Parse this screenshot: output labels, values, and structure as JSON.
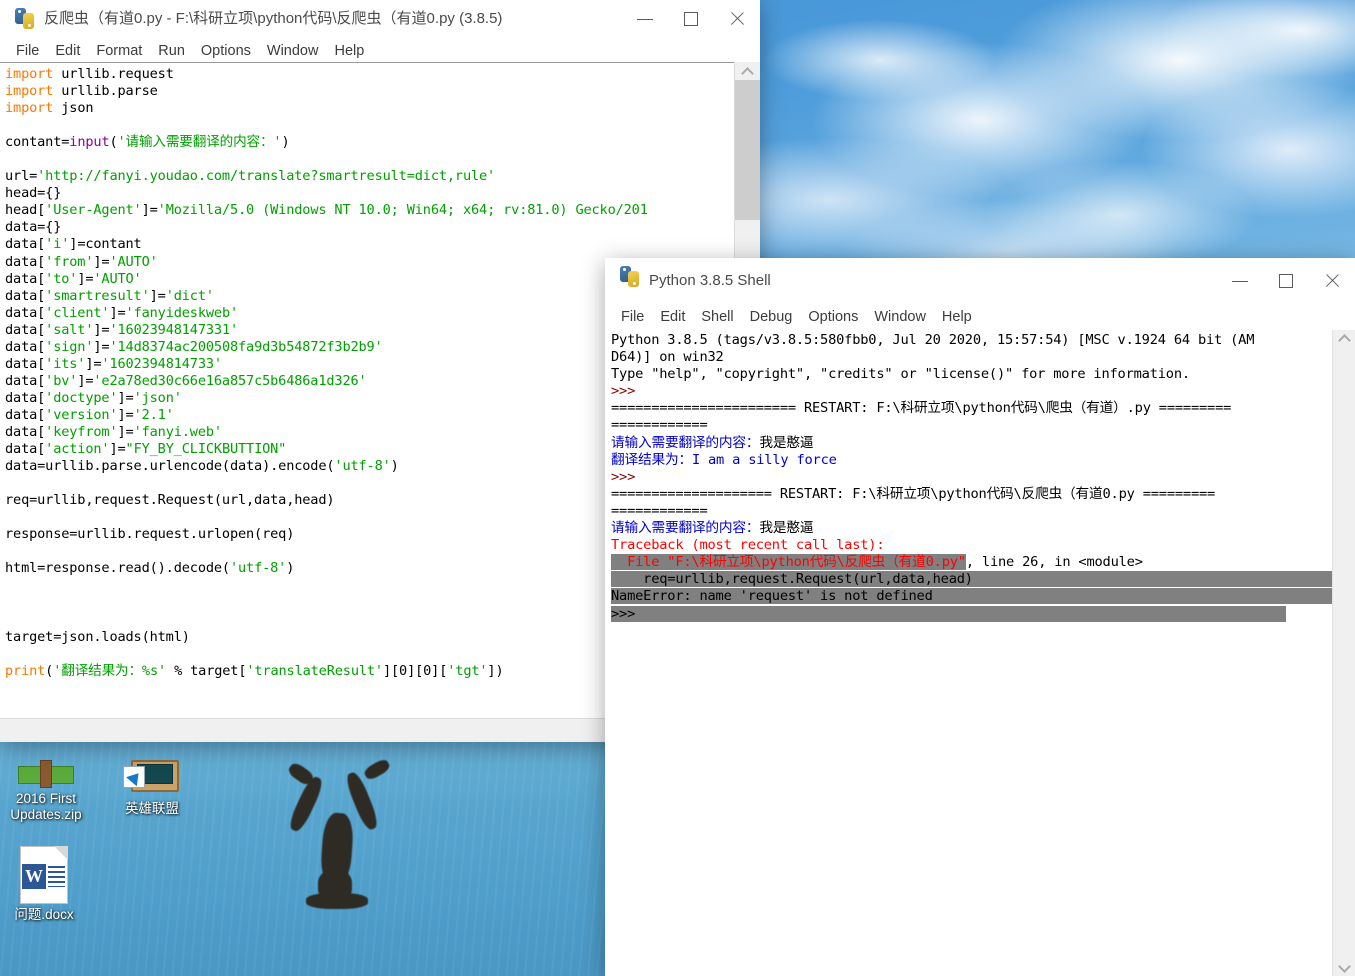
{
  "desktop": {
    "icons": [
      {
        "name": "zip-file-icon",
        "label": "2016 First Updates.zip"
      },
      {
        "name": "lol-shortcut-icon",
        "label": "英雄联盟"
      },
      {
        "name": "word-document-icon",
        "label": "问题.docx"
      }
    ]
  },
  "editor_window": {
    "title": "反爬虫（有道0.py - F:\\科研立项\\python代码\\反爬虫（有道0.py (3.8.5)",
    "icon": "python-logo-icon",
    "menu": [
      "File",
      "Edit",
      "Format",
      "Run",
      "Options",
      "Window",
      "Help"
    ],
    "window_buttons": {
      "minimize": "—",
      "maximize": "▢",
      "close": "✕"
    },
    "code_lines": [
      "import urllib.request",
      "import urllib.parse",
      "import json",
      "",
      "contant=input('请输入需要翻译的内容：')",
      "",
      "url='http://fanyi.youdao.com/translate?smartresult=dict,rule'",
      "head={}",
      "head['User-Agent']='Mozilla/5.0 (Windows NT 10.0; Win64; x64; rv:81.0) Gecko/201",
      "data={}",
      "data['i']=contant",
      "data['from']='AUTO'",
      "data['to']='AUTO'",
      "data['smartresult']='dict'",
      "data['client']='fanyideskweb'",
      "data['salt']='16023948147331'",
      "data['sign']='14d8374ac200508fa9d3b54872f3b2b9'",
      "data['its']='1602394814733'",
      "data['bv']='e2a78ed30c66e16a857c5b6486a1d326'",
      "data['doctype']='json'",
      "data['version']='2.1'",
      "data['keyfrom']='fanyi.web'",
      "data['action']=\"FY_BY_CLICKBUTTION\"",
      "data=urllib.parse.urlencode(data).encode('utf-8')",
      "",
      "req=urllib,request.Request(url,data,head)",
      "",
      "response=urllib.request.urlopen(req)",
      "",
      "html=response.read().decode('utf-8')",
      "",
      "",
      "",
      "target=json.loads(html)",
      "",
      "print('翻译结果为：%s' % target['translateResult'][0][0]['tgt'])"
    ],
    "syntax_colors": {
      "keyword": "#ff7700",
      "builtin": "#900090",
      "string": "#00a000",
      "normal": "#000000"
    }
  },
  "shell_window": {
    "title": "Python 3.8.5 Shell",
    "icon": "python-logo-icon",
    "menu": [
      "File",
      "Edit",
      "Shell",
      "Debug",
      "Options",
      "Window",
      "Help"
    ],
    "window_buttons": {
      "minimize": "—",
      "maximize": "▢",
      "close": "✕"
    },
    "output": {
      "banner_line1": "Python 3.8.5 (tags/v3.8.5:580fbb0, Jul 20 2020, 15:57:54) [MSC v.1924 64 bit (AM",
      "banner_line2": "D64)] on win32",
      "banner_line3": "Type \"help\", \"copyright\", \"credits\" or \"license()\" for more information.",
      "prompt": ">>>",
      "restart1_a": "======================= RESTART: F:\\科研立项\\python代码\\爬虫（有道）.py =========",
      "restart1_b": "============",
      "run1_input_label": "请输入需要翻译的内容：",
      "run1_input_value": "我是憨逼",
      "run1_result_label": "翻译结果为：",
      "run1_result_value": "I am a silly force",
      "restart2_a": "==================== RESTART: F:\\科研立项\\python代码\\反爬虫（有道0.py =========",
      "restart2_b": "============",
      "run2_input_label": "请输入需要翻译的内容：",
      "run2_input_value": "我是憨逼",
      "traceback_header": "Traceback (most recent call last):",
      "traceback_file_prefix": "  File ",
      "traceback_file_path": "\"F:\\科研立项\\python代码\\反爬虫（有道0.py\"",
      "traceback_file_suffix": ", line 26, in <module>",
      "traceback_code": "    req=urllib,request.Request(url,data,head)",
      "error_line": "NameError: name 'request' is not defined"
    },
    "colors": {
      "prompt": "#8b0000",
      "stdout": "#0000cc",
      "error": "#ff0000",
      "selection": "#808080"
    }
  }
}
